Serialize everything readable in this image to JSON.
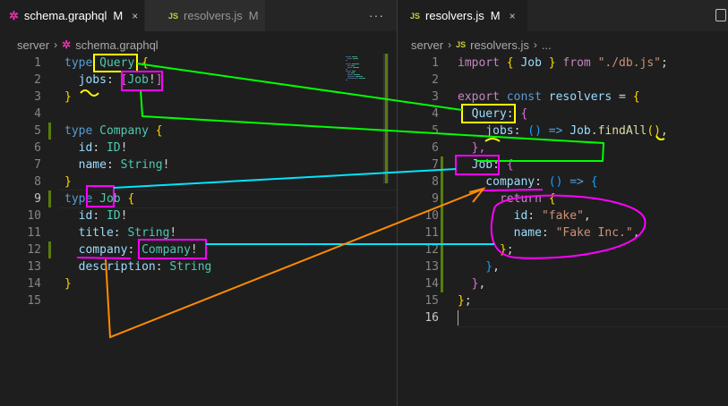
{
  "left_editor": {
    "tabs": [
      {
        "icon": "graphql-icon",
        "label": "schema.graphql",
        "mod": "M",
        "close": "×",
        "active": true
      },
      {
        "icon": "js-icon",
        "icon_text": "JS",
        "label": "resolvers.js",
        "mod": "M",
        "active": false
      }
    ],
    "more": "···",
    "breadcrumb": {
      "folder": "server",
      "file": "schema.graphql"
    },
    "line_numbers": [
      "1",
      "2",
      "3",
      "4",
      "5",
      "6",
      "7",
      "8",
      "9",
      "10",
      "11",
      "12",
      "13",
      "14",
      "15"
    ],
    "lines": [
      [
        [
          "kw",
          "type "
        ],
        [
          "ty",
          "Query"
        ],
        [
          "pu",
          " "
        ],
        [
          "br1",
          "{"
        ]
      ],
      [
        [
          "id",
          "  jobs"
        ],
        [
          "pu",
          ": "
        ],
        [
          "br2",
          "["
        ],
        [
          "ty",
          "Job"
        ],
        [
          "pu",
          "!"
        ],
        [
          "br2",
          "]"
        ]
      ],
      [
        [
          "br1",
          "}"
        ]
      ],
      [],
      [
        [
          "kw",
          "type "
        ],
        [
          "ty",
          "Company"
        ],
        [
          "pu",
          " "
        ],
        [
          "br1",
          "{"
        ]
      ],
      [
        [
          "id",
          "  id"
        ],
        [
          "pu",
          ": "
        ],
        [
          "ty",
          "ID"
        ],
        [
          "pu",
          "!"
        ]
      ],
      [
        [
          "id",
          "  name"
        ],
        [
          "pu",
          ": "
        ],
        [
          "ty",
          "String"
        ],
        [
          "pu",
          "!"
        ]
      ],
      [
        [
          "br1",
          "}"
        ]
      ],
      [
        [
          "kw",
          "type "
        ],
        [
          "ty",
          "Job"
        ],
        [
          "pu",
          " "
        ],
        [
          "br1",
          "{"
        ]
      ],
      [
        [
          "id",
          "  id"
        ],
        [
          "pu",
          ": "
        ],
        [
          "ty",
          "ID"
        ],
        [
          "pu",
          "!"
        ]
      ],
      [
        [
          "id",
          "  title"
        ],
        [
          "pu",
          ": "
        ],
        [
          "ty",
          "String"
        ],
        [
          "pu",
          "!"
        ]
      ],
      [
        [
          "id",
          "  company"
        ],
        [
          "pu",
          ": "
        ],
        [
          "ty",
          "Company"
        ],
        [
          "pu",
          "!"
        ]
      ],
      [
        [
          "id",
          "  description"
        ],
        [
          "pu",
          ": "
        ],
        [
          "ty",
          "String"
        ]
      ],
      [
        [
          "br1",
          "}"
        ]
      ],
      []
    ]
  },
  "right_editor": {
    "tabs": [
      {
        "icon": "js-icon",
        "icon_text": "JS",
        "label": "resolvers.js",
        "mod": "M",
        "close": "×",
        "active": true
      }
    ],
    "breadcrumb": {
      "folder": "server",
      "icon_text": "JS",
      "file": "resolvers.js",
      "more": "..."
    },
    "line_numbers": [
      "1",
      "2",
      "3",
      "4",
      "5",
      "6",
      "7",
      "8",
      "9",
      "10",
      "11",
      "12",
      "13",
      "14",
      "15",
      "16"
    ],
    "lines": [
      [
        [
          "kw2",
          "import "
        ],
        [
          "br1",
          "{ "
        ],
        [
          "id",
          "Job"
        ],
        [
          "br1",
          " }"
        ],
        [
          "kw2",
          " from "
        ],
        [
          "st",
          "\"./db.js\""
        ],
        [
          "pu",
          ";"
        ]
      ],
      [],
      [
        [
          "kw2",
          "export "
        ],
        [
          "kw",
          "const "
        ],
        [
          "id",
          "resolvers"
        ],
        [
          "pu",
          " = "
        ],
        [
          "br1",
          "{"
        ]
      ],
      [
        [
          "id",
          "  Query"
        ],
        [
          "pu",
          ": "
        ],
        [
          "br2",
          "{"
        ]
      ],
      [
        [
          "id",
          "    jobs"
        ],
        [
          "pu",
          ": "
        ],
        [
          "br3",
          "()"
        ],
        [
          "kw",
          " => "
        ],
        [
          "id",
          "Job"
        ],
        [
          "pu",
          "."
        ],
        [
          "fn",
          "findAll"
        ],
        [
          "br1",
          "()"
        ],
        [
          "pu",
          ","
        ]
      ],
      [
        [
          "br2",
          "  },"
        ]
      ],
      [
        [
          "id",
          "  Job"
        ],
        [
          "pu",
          ": "
        ],
        [
          "br2",
          "{"
        ]
      ],
      [
        [
          "id",
          "    company"
        ],
        [
          "pu",
          ": "
        ],
        [
          "br3",
          "()"
        ],
        [
          "kw",
          " => "
        ],
        [
          "br3",
          "{"
        ]
      ],
      [
        [
          "kw2",
          "      return "
        ],
        [
          "br1",
          "{"
        ]
      ],
      [
        [
          "id",
          "        id"
        ],
        [
          "pu",
          ": "
        ],
        [
          "st",
          "\"fake\""
        ],
        [
          "pu",
          ","
        ]
      ],
      [
        [
          "id",
          "        name"
        ],
        [
          "pu",
          ": "
        ],
        [
          "st",
          "\"Fake Inc.\""
        ],
        [
          "pu",
          ","
        ]
      ],
      [
        [
          "br1",
          "      }"
        ],
        [
          "pu",
          ";"
        ]
      ],
      [
        [
          "br3",
          "    }"
        ],
        [
          "pu",
          ","
        ]
      ],
      [
        [
          "br2",
          "  }"
        ],
        [
          "pu",
          ","
        ]
      ],
      [
        [
          "br1",
          "}"
        ],
        [
          "pu",
          ";"
        ]
      ],
      []
    ]
  },
  "colors": {
    "yellow_box": "#ffff00",
    "magenta_box": "#ff00ff",
    "green_line": "#00ff00",
    "cyan_line": "#00e5ff",
    "orange_line": "#ff8c00"
  }
}
